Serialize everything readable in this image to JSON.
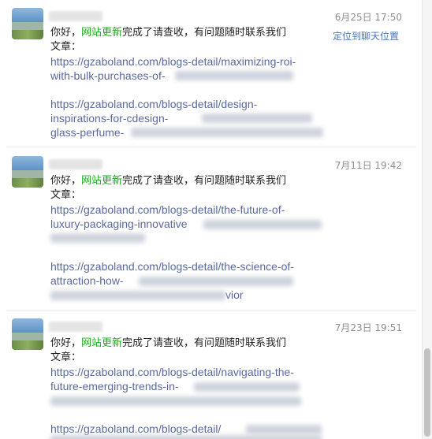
{
  "locate_link": "定位到聊天位置",
  "greeting_prefix": "你好，",
  "brand": "网站更新",
  "greeting_suffix": "完成了请查收，有问题随时联系我们",
  "article_label": "文章：",
  "messages": [
    {
      "time": "6月25日 17:50",
      "link1": [
        "https://gzaboland.com/blogs-detail/maximizing-roi-",
        "with-bulk-purchases-of-"
      ],
      "link2": [
        "https://gzaboland.com/blogs-detail/design-",
        "inspirations-for-cdesign-",
        "glass-perfume-"
      ]
    },
    {
      "time": "7月11日 19:42",
      "link1": [
        "https://gzaboland.com/blogs-detail/the-future-of-",
        "luxury-packaging-innovative"
      ],
      "link2": [
        "https://gzaboland.com/blogs-detail/the-science-of-",
        "attraction-how-",
        "vior"
      ]
    },
    {
      "time": "7月23日 19:51",
      "link1": [
        "https://gzaboland.com/blogs-detail/navigating-the-",
        "future-emerging-trends-in-"
      ],
      "link2": [
        "https://gzaboland.com/blogs-detail/"
      ]
    }
  ]
}
